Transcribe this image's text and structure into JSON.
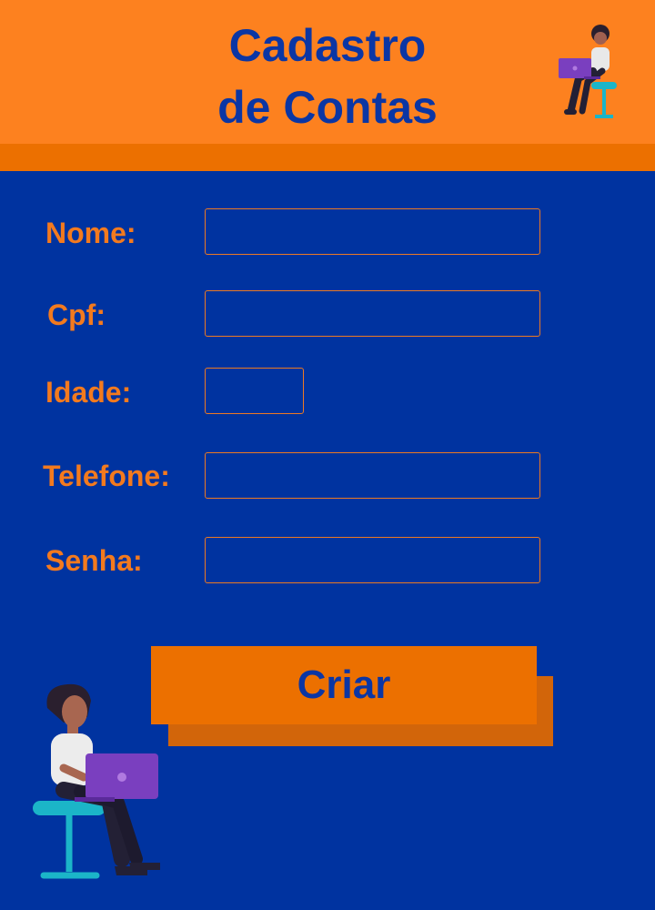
{
  "header": {
    "title_line1": "Cadastro",
    "title_line2": "de Contas"
  },
  "form": {
    "name_label": "Nome:",
    "name_value": "",
    "cpf_label": "Cpf:",
    "cpf_value": "",
    "age_label": "Idade:",
    "age_value": "",
    "phone_label": "Telefone:",
    "phone_value": "",
    "password_label": "Senha:",
    "password_value": "",
    "submit_label": "Criar"
  },
  "colors": {
    "background": "#0033a0",
    "header": "#fd811f",
    "accent": "#ec7000",
    "title": "#0b36a4"
  },
  "icons": [
    "person-laptop-illustration-small",
    "person-laptop-illustration-large"
  ]
}
